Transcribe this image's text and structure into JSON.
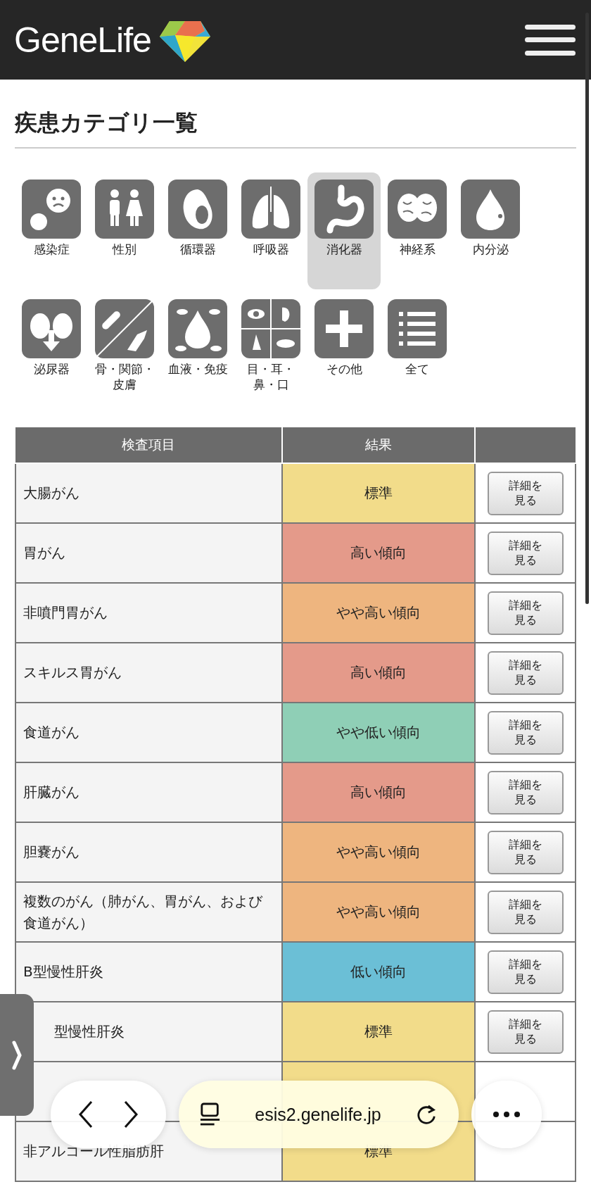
{
  "header": {
    "logo": "GeneLife"
  },
  "title": "疾患カテゴリ一覧",
  "categories": [
    {
      "label": "感染症",
      "selected": false
    },
    {
      "label": "性別",
      "selected": false
    },
    {
      "label": "循環器",
      "selected": false
    },
    {
      "label": "呼吸器",
      "selected": false
    },
    {
      "label": "消化器",
      "selected": true
    },
    {
      "label": "神経系",
      "selected": false
    },
    {
      "label": "内分泌",
      "selected": false
    },
    {
      "label": "泌尿器",
      "selected": false
    },
    {
      "label": "骨・関節・皮膚",
      "selected": false
    },
    {
      "label": "血液・免疫",
      "selected": false
    },
    {
      "label": "目・耳・鼻・口",
      "selected": false
    },
    {
      "label": "その他",
      "selected": false
    },
    {
      "label": "全て",
      "selected": false
    }
  ],
  "table": {
    "columns": [
      "検査項目",
      "結果"
    ],
    "rows": [
      {
        "name": "大腸がん",
        "result": "標準",
        "color": "#f2dc8a",
        "button": "詳細を見る"
      },
      {
        "name": "胃がん",
        "result": "高い傾向",
        "color": "#e49a8a",
        "button": "詳細を見る"
      },
      {
        "name": "非噴門胃がん",
        "result": "やや高い傾向",
        "color": "#eeb57f",
        "button": "詳細を見る"
      },
      {
        "name": "スキルス胃がん",
        "result": "高い傾向",
        "color": "#e49a8a",
        "button": "詳細を見る"
      },
      {
        "name": "食道がん",
        "result": "やや低い傾向",
        "color": "#8fcfb6",
        "button": "詳細を見る"
      },
      {
        "name": "肝臓がん",
        "result": "高い傾向",
        "color": "#e49a8a",
        "button": "詳細を見る"
      },
      {
        "name": "胆嚢がん",
        "result": "やや高い傾向",
        "color": "#eeb57f",
        "button": "詳細を見る"
      },
      {
        "name": "複数のがん（肺がん、胃がん、および食道がん）",
        "result": "やや高い傾向",
        "color": "#eeb57f",
        "button": "詳細を見る"
      },
      {
        "name": "B型慢性肝炎",
        "result": "低い傾向",
        "color": "#6bbfd6",
        "button": "詳細を見る"
      },
      {
        "name": "型慢性肝炎",
        "result": "標準",
        "color": "#f2dc8a",
        "button": "詳細を見る"
      },
      {
        "color": "#f2dc8a"
      },
      {
        "name": "非アルコール性脂肪肝",
        "result": "標準",
        "color": "#f2dc8a"
      }
    ]
  },
  "browser_bar": {
    "url": "esis2.genelife.jp"
  }
}
